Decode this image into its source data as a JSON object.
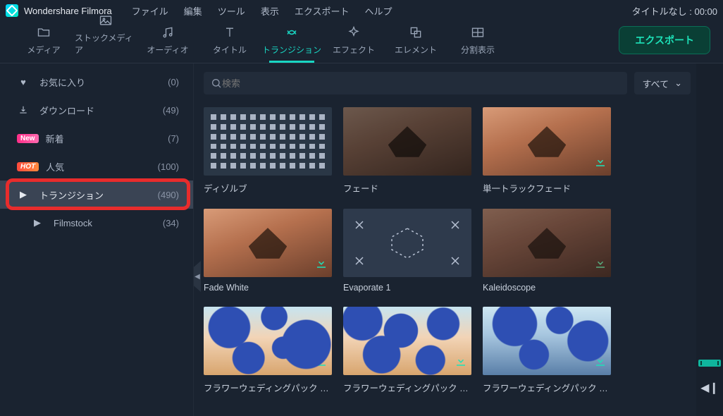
{
  "titlebar": {
    "product": "Wondershare Filmora",
    "menus": [
      "ファイル",
      "編集",
      "ツール",
      "表示",
      "エクスポート",
      "ヘルプ"
    ],
    "right": "タイトルなし : 00:00"
  },
  "toolbar": {
    "items": [
      {
        "label": "メディア",
        "icon": "folder"
      },
      {
        "label": "ストックメディア",
        "icon": "image"
      },
      {
        "label": "オーディオ",
        "icon": "music"
      },
      {
        "label": "タイトル",
        "icon": "text"
      },
      {
        "label": "トランジション",
        "icon": "transition",
        "active": true
      },
      {
        "label": "エフェクト",
        "icon": "sparkle"
      },
      {
        "label": "エレメント",
        "icon": "layers"
      },
      {
        "label": "分割表示",
        "icon": "split"
      }
    ],
    "export": "エクスポート"
  },
  "sidebar": [
    {
      "icon": "heart",
      "label": "お気に入り",
      "count": "(0)"
    },
    {
      "icon": "download",
      "label": "ダウンロード",
      "count": "(49)"
    },
    {
      "badge": "New",
      "label": "新着",
      "count": "(7)"
    },
    {
      "badge": "HOT",
      "label": "人気",
      "count": "(100)"
    },
    {
      "icon": "play",
      "label": "トランジション",
      "count": "(490)",
      "selected": true
    },
    {
      "icon": "play",
      "label": "Filmstock",
      "count": "(34)",
      "sub": true
    }
  ],
  "search": {
    "placeholder": "検索"
  },
  "filter": {
    "label": "すべて"
  },
  "grid": [
    {
      "label": "ディゾルブ",
      "thumb": "dissolve"
    },
    {
      "label": "フェード",
      "thumb": "photo-faded"
    },
    {
      "label": "単一トラックフェード",
      "thumb": "photo",
      "download": true
    },
    {
      "label": "Fade White",
      "thumb": "photo",
      "download": true
    },
    {
      "label": "Evaporate 1",
      "thumb": "evaporate",
      "download": true
    },
    {
      "label": "Kaleidoscope",
      "thumb": "photo-kale",
      "download": true
    },
    {
      "label": "フラワーウェディングパック トラ…",
      "thumb": "flower",
      "download": true
    },
    {
      "label": "フラワーウェディングパック トラ…",
      "thumb": "flower2",
      "download": true
    },
    {
      "label": "フラワーウェディングパック トラ…",
      "thumb": "flower3",
      "download": true
    }
  ]
}
